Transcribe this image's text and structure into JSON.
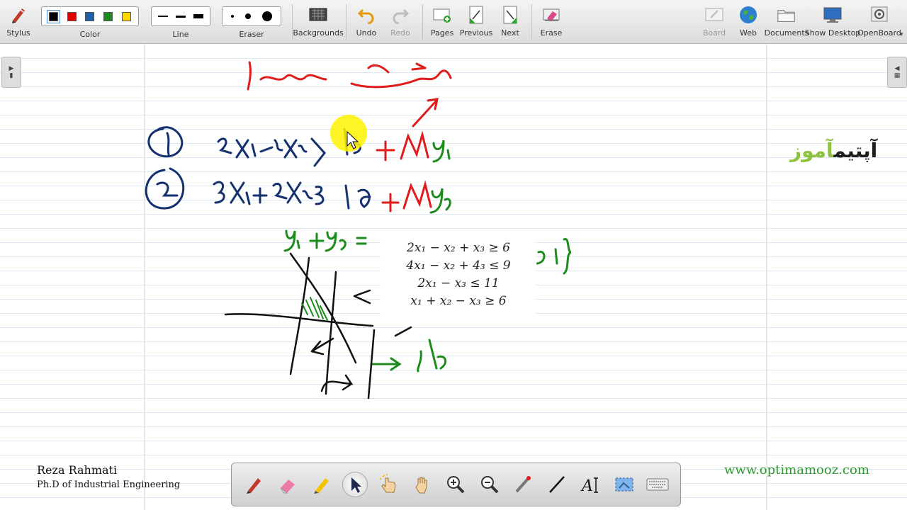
{
  "toolbar": {
    "stylus": "Stylus",
    "color": "Color",
    "line": "Line",
    "eraser": "Eraser",
    "backgrounds": "Backgrounds",
    "undo": "Undo",
    "redo": "Redo",
    "pages": "Pages",
    "previous": "Previous",
    "next": "Next",
    "erase": "Erase",
    "board": "Board",
    "web": "Web",
    "documents": "Documents",
    "show_desktop": "Show Desktop",
    "openboard": "OpenBoard"
  },
  "colors": {
    "palette": [
      "#000000",
      "#e00000",
      "#1f5fa8",
      "#1c8a1c",
      "#ffd700"
    ],
    "ink_red": "#e01b1b",
    "ink_blue": "#14306e",
    "ink_green": "#1d8c1d",
    "ink_black": "#111111",
    "highlight": "#fff200"
  },
  "board": {
    "formulas": [
      "2x₁ − x₂ + x₃ ≥ 6",
      "4x₁ − x₂ + 4₃ ≤ 9",
      "2x₁ − x₃ ≤ 11",
      "x₁ + x₂ − x₃ ≥ 6"
    ],
    "brand_dark": "آپتیم",
    "brand_green": "آموز"
  },
  "footer": {
    "author_name": "Reza Rahmati",
    "author_title": "Ph.D of Industrial Engineering",
    "website": "www.optimamooz.com"
  }
}
